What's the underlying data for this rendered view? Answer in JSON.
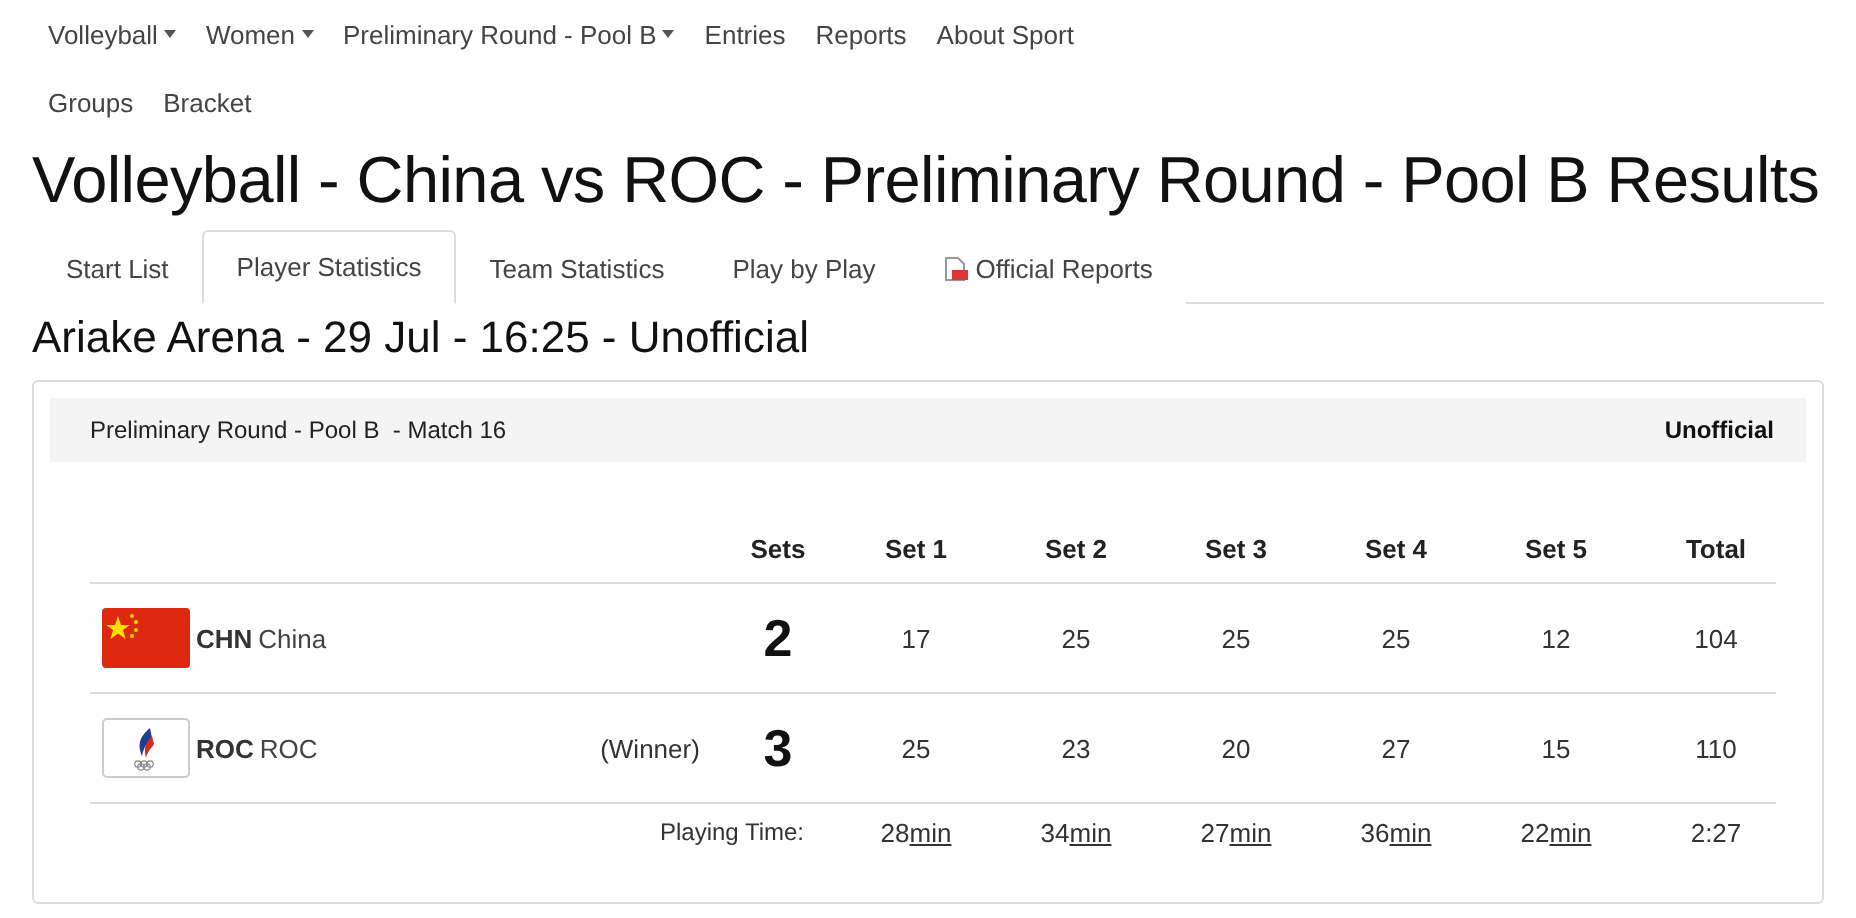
{
  "nav": {
    "rows": [
      [
        {
          "label": "Volleyball",
          "dropdown": true
        },
        {
          "label": "Women",
          "dropdown": true
        },
        {
          "label": "Preliminary Round - Pool B",
          "dropdown": true
        },
        {
          "label": "Entries",
          "dropdown": false
        },
        {
          "label": "Reports",
          "dropdown": false
        },
        {
          "label": "About Sport",
          "dropdown": false
        }
      ],
      [
        {
          "label": "Groups",
          "dropdown": false
        },
        {
          "label": "Bracket",
          "dropdown": false
        }
      ]
    ]
  },
  "title": "Volleyball - China vs ROC - Preliminary Round - Pool B Results",
  "tabs": [
    {
      "label": "Start List",
      "selected": false,
      "icon": false
    },
    {
      "label": "Player Statistics",
      "selected": true,
      "icon": false
    },
    {
      "label": "Team Statistics",
      "selected": false,
      "icon": false
    },
    {
      "label": "Play by Play",
      "selected": false,
      "icon": false
    },
    {
      "label": "Official Reports",
      "selected": false,
      "icon": true
    }
  ],
  "subtitle": "Ariake Arena - 29 Jul - 16:25 - Unofficial",
  "match": {
    "name": "Preliminary Round - Pool B  - Match 16",
    "status": "Unofficial"
  },
  "table": {
    "columns": [
      "Sets",
      "Set 1",
      "Set 2",
      "Set 3",
      "Set 4",
      "Set 5",
      "Total"
    ],
    "rows": [
      {
        "kind": "china",
        "code": "CHN",
        "name": "China",
        "sets": "2",
        "scores": [
          "17",
          "25",
          "25",
          "25",
          "12"
        ],
        "total": "104"
      },
      {
        "kind": "roc",
        "code": "ROC",
        "name": "ROC",
        "note": "(Winner)",
        "sets": "3",
        "scores": [
          "25",
          "23",
          "20",
          "27",
          "15"
        ],
        "total": "110"
      }
    ],
    "playing_time": {
      "label": "Playing Time:",
      "sets": [
        {
          "value": "28",
          "unit": "min"
        },
        {
          "value": "34",
          "unit": "min"
        },
        {
          "value": "27",
          "unit": "min"
        },
        {
          "value": "36",
          "unit": "min"
        },
        {
          "value": "22",
          "unit": "min"
        }
      ],
      "total": "2:27"
    }
  }
}
